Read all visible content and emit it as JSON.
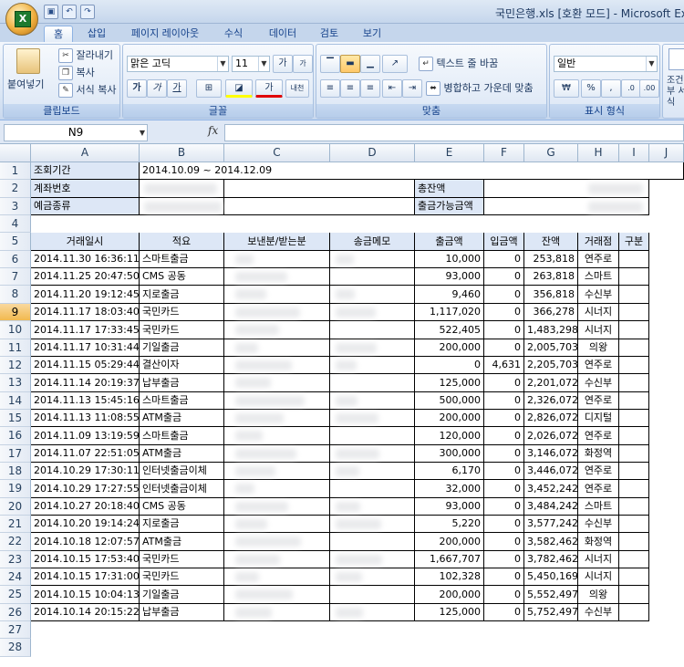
{
  "window": {
    "title": "국민은행.xls [호환 모드] - Microsoft Excel",
    "office_logo": "X"
  },
  "qat": [
    "save-icon",
    "undo-icon",
    "redo-icon"
  ],
  "tabs": [
    "홈",
    "삽입",
    "페이지 레이아웃",
    "수식",
    "데이터",
    "검토",
    "보기"
  ],
  "ribbon": {
    "clipboard": {
      "paste": "붙여넣기",
      "cut": "잘라내기",
      "copy": "복사",
      "format_painter": "서식 복사",
      "label": "클립보드"
    },
    "font": {
      "name": "맑은 고딕",
      "size": "11",
      "grow": "가",
      "shrink": "가",
      "bold": "가",
      "italic": "가",
      "underline": "가",
      "color_a": "가",
      "phonetic": "내천",
      "label": "글꼴"
    },
    "alignment": {
      "wrap": "텍스트 줄 바꿈",
      "merge": "병합하고 가운데 맞춤",
      "label": "맞춤"
    },
    "number": {
      "format": "일반",
      "currency": "₩",
      "percent": "%",
      "comma": ",",
      "label": "표시 형식"
    },
    "styles": {
      "label": "조건부 서식"
    }
  },
  "formula_bar": {
    "name_box": "N9",
    "fx": "fx",
    "value": ""
  },
  "columns": [
    "A",
    "B",
    "C",
    "D",
    "E",
    "F",
    "G",
    "H",
    "I",
    "J"
  ],
  "rows": [
    "1",
    "2",
    "3",
    "4",
    "5",
    "6",
    "7",
    "8",
    "9",
    "10",
    "11",
    "12",
    "13",
    "14",
    "15",
    "16",
    "17",
    "18",
    "19",
    "20",
    "21",
    "22",
    "23",
    "24",
    "25",
    "26",
    "27",
    "28"
  ],
  "selected_row": "9",
  "info": {
    "period_label": "조회기간",
    "period_value": "2014.10.09 ~ 2014.12.09",
    "account_label": "계좌번호",
    "balance_label": "총잔액",
    "deposit_type_label": "예금종류",
    "withdrawable_label": "출금가능금액"
  },
  "table": {
    "headers": [
      "거래일시",
      "적요",
      "보낸분/받는분",
      "송금메모",
      "출금액",
      "입금액",
      "잔액",
      "거래점",
      "구분"
    ],
    "rows": [
      [
        "2014.11.30 16:36:11",
        "스마트출금",
        "",
        "",
        "10,000",
        "0",
        "253,818",
        "연주로",
        ""
      ],
      [
        "2014.11.25 20:47:50",
        "CMS 공동",
        "",
        "",
        "93,000",
        "0",
        "263,818",
        "스마트",
        ""
      ],
      [
        "2014.11.20 19:12:45",
        "지로출금",
        "",
        "",
        "9,460",
        "0",
        "356,818",
        "수신부",
        ""
      ],
      [
        "2014.11.17 18:03:40",
        "국민카드",
        "",
        "",
        "1,117,020",
        "0",
        "366,278",
        "시너지",
        ""
      ],
      [
        "2014.11.17 17:33:45",
        "국민카드",
        "",
        "",
        "522,405",
        "0",
        "1,483,298",
        "시너지",
        ""
      ],
      [
        "2014.11.17 10:31:44",
        "기일출금",
        "",
        "",
        "200,000",
        "0",
        "2,005,703",
        "의왕",
        ""
      ],
      [
        "2014.11.15 05:29:44",
        "결산이자",
        "",
        "",
        "0",
        "4,631",
        "2,205,703",
        "연주로",
        ""
      ],
      [
        "2014.11.14 20:19:37",
        "납부출금",
        "",
        "",
        "125,000",
        "0",
        "2,201,072",
        "수신부",
        ""
      ],
      [
        "2014.11.13 15:45:16",
        "스마트출금",
        "",
        "",
        "500,000",
        "0",
        "2,326,072",
        "연주로",
        ""
      ],
      [
        "2014.11.13 11:08:55",
        "ATM출금",
        "",
        "",
        "200,000",
        "0",
        "2,826,072",
        "디지털",
        ""
      ],
      [
        "2014.11.09 13:19:59",
        "스마트출금",
        "",
        "",
        "120,000",
        "0",
        "2,026,072",
        "연주로",
        ""
      ],
      [
        "2014.11.07 22:51:05",
        "ATM출금",
        "",
        "",
        "300,000",
        "0",
        "3,146,072",
        "화정역",
        ""
      ],
      [
        "2014.10.29 17:30:11",
        "인터넷출금이체",
        "",
        "",
        "6,170",
        "0",
        "3,446,072",
        "연주로",
        ""
      ],
      [
        "2014.10.29 17:27:55",
        "인터넷출금이체",
        "",
        "",
        "32,000",
        "0",
        "3,452,242",
        "연주로",
        ""
      ],
      [
        "2014.10.27 20:18:40",
        "CMS 공동",
        "",
        "",
        "93,000",
        "0",
        "3,484,242",
        "스마트",
        ""
      ],
      [
        "2014.10.20 19:14:24",
        "지로출금",
        "",
        "",
        "5,220",
        "0",
        "3,577,242",
        "수신부",
        ""
      ],
      [
        "2014.10.18 12:07:57",
        "ATM출금",
        "",
        "",
        "200,000",
        "0",
        "3,582,462",
        "화정역",
        ""
      ],
      [
        "2014.10.15 17:53:40",
        "국민카드",
        "",
        "",
        "1,667,707",
        "0",
        "3,782,462",
        "시너지",
        ""
      ],
      [
        "2014.10.15 17:31:00",
        "국민카드",
        "",
        "",
        "102,328",
        "0",
        "5,450,169",
        "시너지",
        ""
      ],
      [
        "2014.10.15 10:04:13",
        "기일출금",
        "",
        "",
        "200,000",
        "0",
        "5,552,497",
        "의왕",
        ""
      ],
      [
        "2014.10.14 20:15:22",
        "납부출금",
        "",
        "",
        "125,000",
        "0",
        "5,752,497",
        "수신부",
        ""
      ]
    ]
  }
}
